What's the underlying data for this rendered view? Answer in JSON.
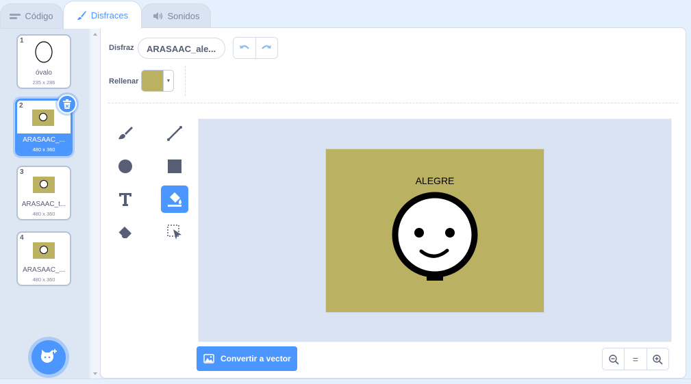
{
  "tabs": [
    {
      "label": "Código",
      "icon": "code-icon",
      "active": false
    },
    {
      "label": "Disfraces",
      "icon": "brush-icon",
      "active": true
    },
    {
      "label": "Sonidos",
      "icon": "speaker-icon",
      "active": false
    }
  ],
  "costumes": [
    {
      "number": "1",
      "name": "óvalo",
      "dims": "235 x 286",
      "selected": false
    },
    {
      "number": "2",
      "name": "ARASAAC_...",
      "dims": "480 x 360",
      "selected": true
    },
    {
      "number": "3",
      "name": "ARASAAC_t...",
      "dims": "480 x 360",
      "selected": false
    },
    {
      "number": "4",
      "name": "ARASAAC_...",
      "dims": "480 x 360",
      "selected": false
    }
  ],
  "editor": {
    "costume_label": "Disfraz",
    "costume_name": "ARASAAC_ale...",
    "fill_label": "Rellenar",
    "fill_color": "#bbb163",
    "canvas_text": "ALEGRE",
    "convert_label": "Convertir a vector",
    "zoom_reset": "="
  },
  "tools": [
    "brush-tool",
    "line-tool",
    "circle-tool",
    "rectangle-tool",
    "text-tool",
    "fill-tool",
    "eraser-tool",
    "select-tool"
  ],
  "active_tool": "fill-tool",
  "colors": {
    "accent": "#4c97ff",
    "background": "#e5f0ff",
    "text": "#575e75"
  }
}
